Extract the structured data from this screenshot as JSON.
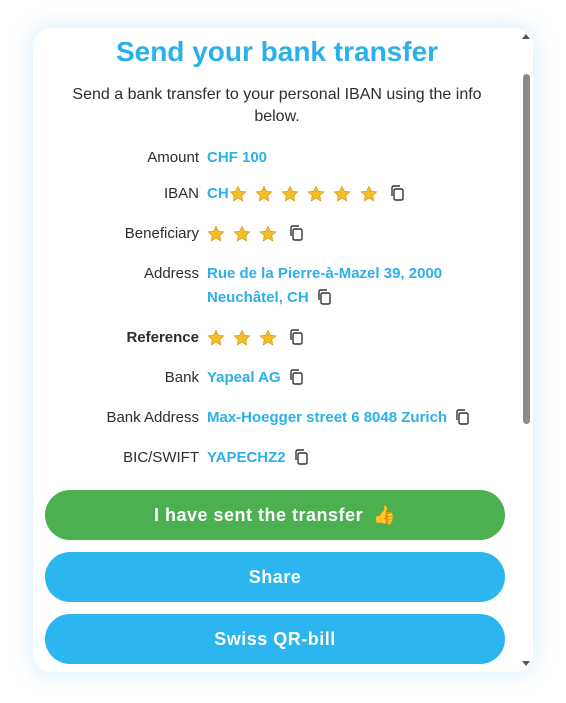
{
  "title": "Send your bank transfer",
  "subtitle": "Send a bank transfer to your personal IBAN using the info below.",
  "fields": {
    "amount": {
      "label": "Amount",
      "value": "CHF 100"
    },
    "iban": {
      "label": "IBAN",
      "value_prefix": "CH",
      "masked_stars": 6
    },
    "beneficiary": {
      "label": "Beneficiary",
      "masked_stars": 3
    },
    "address": {
      "label": "Address",
      "line1": "Rue de la Pierre-à-Mazel 39, 2000",
      "line2": "Neuchâtel, CH"
    },
    "reference": {
      "label": "Reference",
      "masked_stars": 3
    },
    "bank": {
      "label": "Bank",
      "value": "Yapeal AG"
    },
    "bank_address": {
      "label": "Bank Address",
      "value": "Max-Hoegger street 6 8048 Zurich"
    },
    "bic": {
      "label": "BIC/SWIFT",
      "value": "YAPECHZ2"
    }
  },
  "buttons": {
    "sent": "I have sent the transfer",
    "share": "Share",
    "qr": "Swiss QR-bill"
  },
  "colors": {
    "accent": "#2cb0ea",
    "green": "#4caf50",
    "blue": "#2cb5ef"
  }
}
